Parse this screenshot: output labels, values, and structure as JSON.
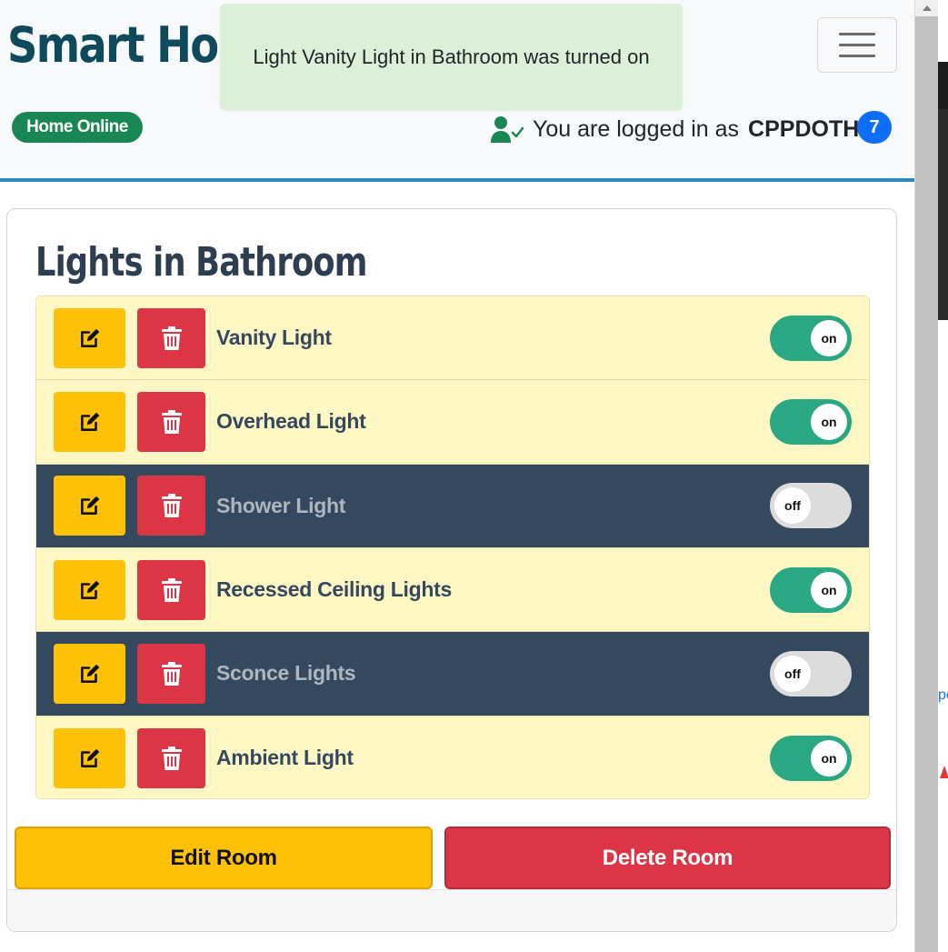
{
  "header": {
    "brand": "Smart Hom",
    "status": "Home Online",
    "user_prefix": "You are logged in as",
    "username": "CPPDOTH",
    "notification_count": "7"
  },
  "toast": {
    "message": "Light Vanity Light in Bathroom was turned on"
  },
  "room": {
    "title": "Lights in Bathroom",
    "lights": [
      {
        "name": "Vanity Light",
        "state": "on"
      },
      {
        "name": "Overhead Light",
        "state": "on"
      },
      {
        "name": "Shower Light",
        "state": "off"
      },
      {
        "name": "Recessed Ceiling Lights",
        "state": "on"
      },
      {
        "name": "Sconce Lights",
        "state": "off"
      },
      {
        "name": "Ambient Light",
        "state": "on"
      }
    ],
    "edit_room_label": "Edit Room",
    "delete_room_label": "Delete Room"
  },
  "side": {
    "link_fragment": "pe"
  },
  "colors": {
    "brand": "#0e4a5c",
    "online": "#198754",
    "accent_line": "#2e86c1",
    "toggle_on": "#2aa884",
    "toggle_off": "#dcdcdc",
    "warning": "#ffc107",
    "danger": "#dc3545",
    "row_on": "#fff8c5",
    "row_off": "#34495e"
  },
  "icons": {
    "edit": "edit-icon",
    "delete": "trash-icon",
    "user": "user-check-icon",
    "menu": "hamburger-icon"
  }
}
